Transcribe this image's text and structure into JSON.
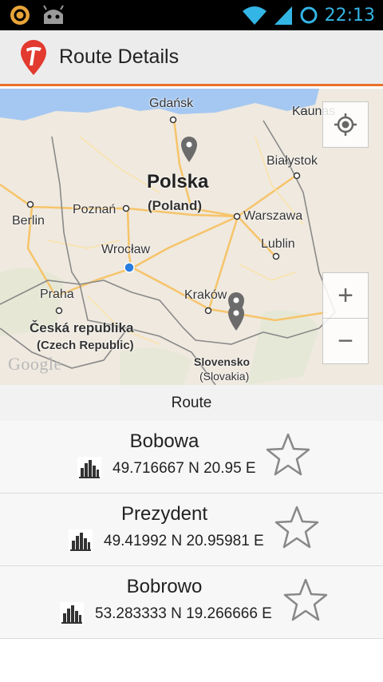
{
  "status_bar": {
    "time": "22:13",
    "icons": [
      "notification-icon",
      "android-debug-icon",
      "wifi-icon",
      "signal-icon",
      "sync-icon"
    ]
  },
  "action_bar": {
    "title": "Route Details",
    "logo": "app-logo"
  },
  "map": {
    "labels": {
      "gdansk": "Gdańsk",
      "kaunas": "Kaunas",
      "polska": "Polska",
      "poland": "(Poland)",
      "bialystok": "Białystok",
      "berlin": "Berlin",
      "poznan": "Poznań",
      "warszawa": "Warszawa",
      "lublin": "Lublin",
      "wroclaw": "Wrocław",
      "praha": "Praha",
      "krakow": "Kraków",
      "ceska": "Česká republika",
      "czech": "(Czech Republic)",
      "slovensko": "Slovensko",
      "slovakia": "(Slovakia)"
    },
    "attribution": "Google",
    "zoom_in": "+",
    "zoom_out": "−",
    "colors": {
      "land": "#efe9df",
      "water": "#a5c8f2",
      "road": "#f6c46a",
      "border": "#888888"
    }
  },
  "route": {
    "header": "Route",
    "items": [
      {
        "name": "Bobowa",
        "coords": "49.716667 N 20.95 E",
        "icon": "city-icon",
        "favorite_icon": "star-outline-icon"
      },
      {
        "name": "Prezydent",
        "coords": "49.41992 N 20.95981 E",
        "icon": "city-icon",
        "favorite_icon": "star-outline-icon"
      },
      {
        "name": "Bobrowo",
        "coords": "53.283333 N 19.266666 E",
        "icon": "city-icon",
        "favorite_icon": "star-outline-icon"
      }
    ]
  }
}
